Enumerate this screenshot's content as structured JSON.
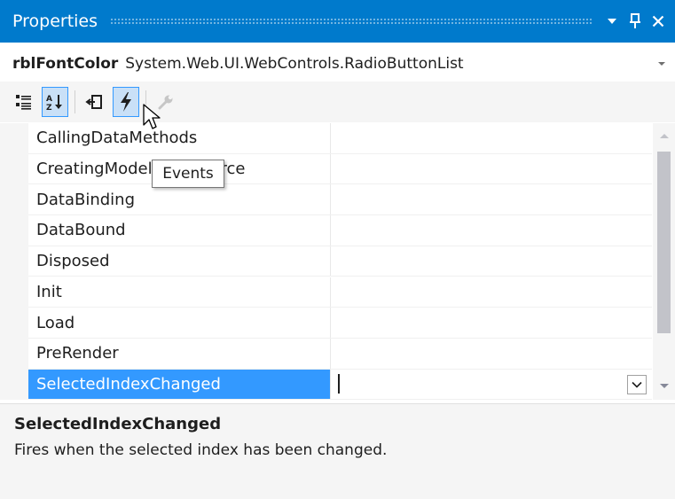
{
  "window": {
    "title": "Properties",
    "buttons": [
      "window-position-menu",
      "auto-hide-pin",
      "close"
    ]
  },
  "object_selector": {
    "name": "rblFontColor",
    "type": "System.Web.UI.WebControls.RadioButtonList"
  },
  "toolbar": {
    "tools": [
      {
        "icon": "categorized-icon",
        "state": "normal"
      },
      {
        "icon": "alphabetical-sort-icon",
        "state": "pressed"
      },
      {
        "icon": "properties-icon",
        "state": "normal"
      },
      {
        "icon": "lightning-events-icon",
        "state": "pressed"
      },
      {
        "icon": "wrench-property-pages-icon",
        "state": "disabled"
      }
    ]
  },
  "tooltip": {
    "text": "Events"
  },
  "grid": {
    "events": [
      {
        "name": "CallingDataMethods",
        "value": ""
      },
      {
        "name": "CreatingModelDataSource",
        "value": ""
      },
      {
        "name": "DataBinding",
        "value": ""
      },
      {
        "name": "DataBound",
        "value": ""
      },
      {
        "name": "Disposed",
        "value": ""
      },
      {
        "name": "Init",
        "value": ""
      },
      {
        "name": "Load",
        "value": ""
      },
      {
        "name": "PreRender",
        "value": ""
      },
      {
        "name": "SelectedIndexChanged",
        "value": ""
      }
    ],
    "selected_index": 8
  },
  "description": {
    "title": "SelectedIndexChanged",
    "text": "Fires when the selected index has been changed."
  },
  "colors": {
    "title_bar": "#007acc",
    "selection": "#3399ff",
    "panel_background": "#f5f5f5",
    "scroll_thumb": "#c2c3c9"
  }
}
